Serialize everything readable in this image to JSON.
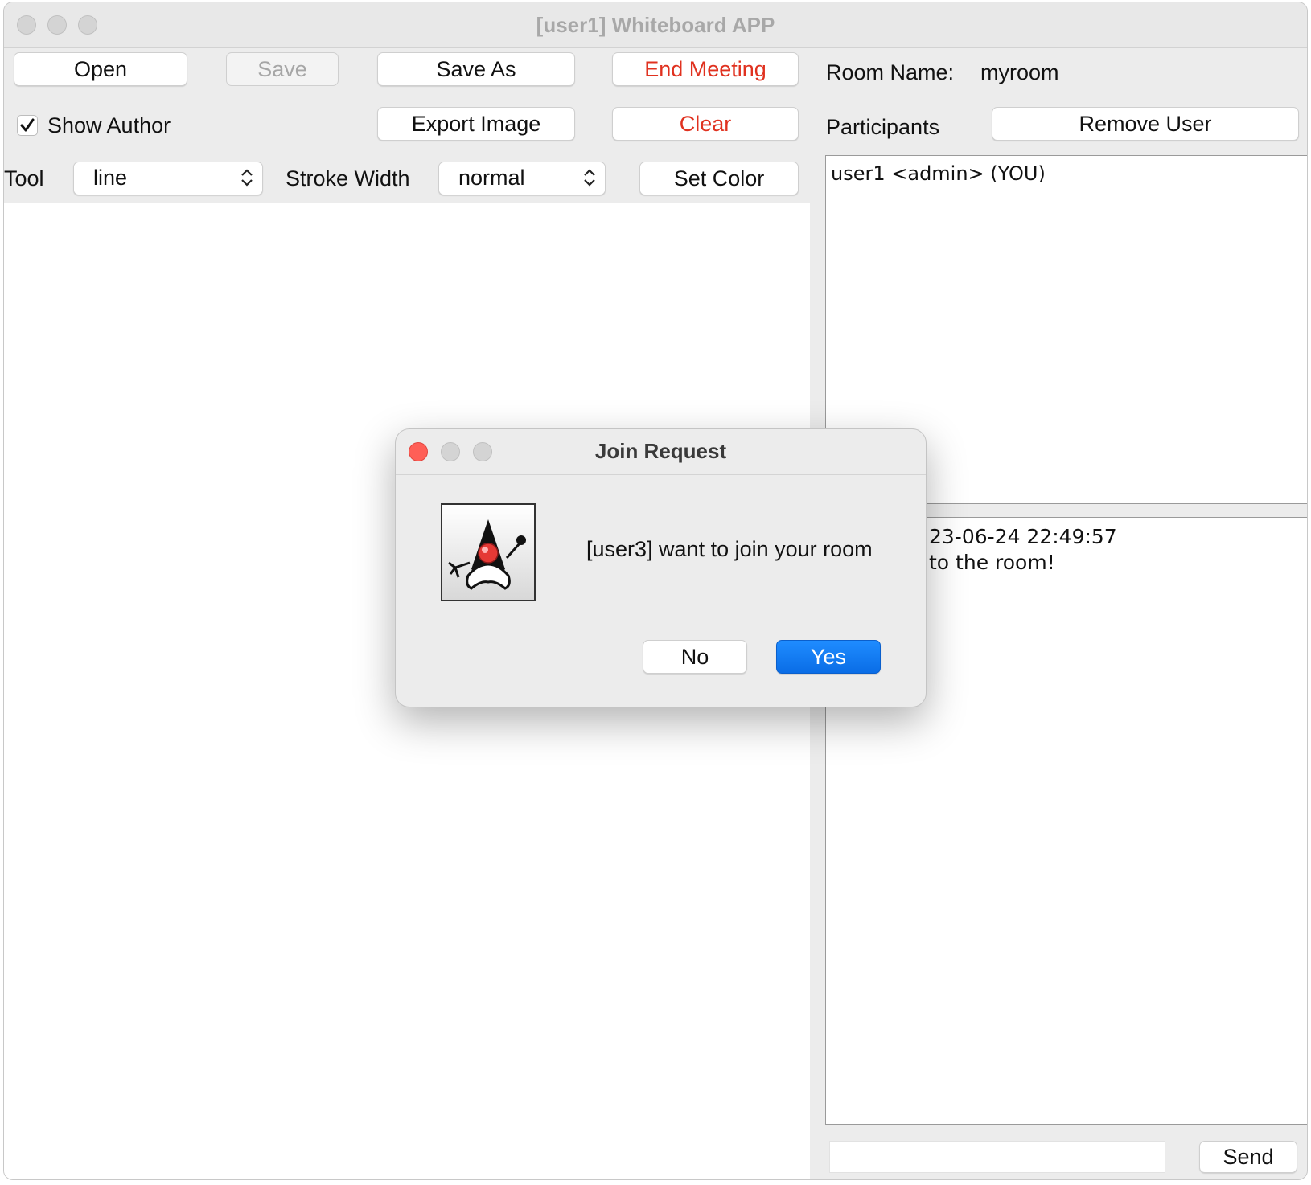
{
  "window": {
    "title": "[user1] Whiteboard APP"
  },
  "toolbar": {
    "open_label": "Open",
    "save_label": "Save",
    "save_as_label": "Save As",
    "end_meeting_label": "End Meeting",
    "export_image_label": "Export Image",
    "clear_label": "Clear",
    "set_color_label": "Set Color",
    "show_author_label": "Show Author",
    "show_author_checked": true,
    "tool_label": "Tool",
    "tool_value": "line",
    "stroke_width_label": "Stroke Width",
    "stroke_width_value": "normal"
  },
  "side_panel": {
    "room_name_label": "Room Name:",
    "room_name_value": "myroom",
    "participants_label": "Participants",
    "remove_user_label": "Remove User",
    "participants": [
      "user1 <admin> (YOU)"
    ],
    "chat_lines": [
      "23-06-24 22:49:57",
      "to the room!"
    ],
    "chat_input_value": "",
    "send_label": "Send"
  },
  "dialog": {
    "title": "Join Request",
    "message": "[user3] want to join your room",
    "no_label": "No",
    "yes_label": "Yes",
    "icon": "java-duke-icon"
  },
  "colors": {
    "danger_text": "#e0311f",
    "primary_button": "#0a6de6",
    "close_button": "#ff5f57"
  }
}
